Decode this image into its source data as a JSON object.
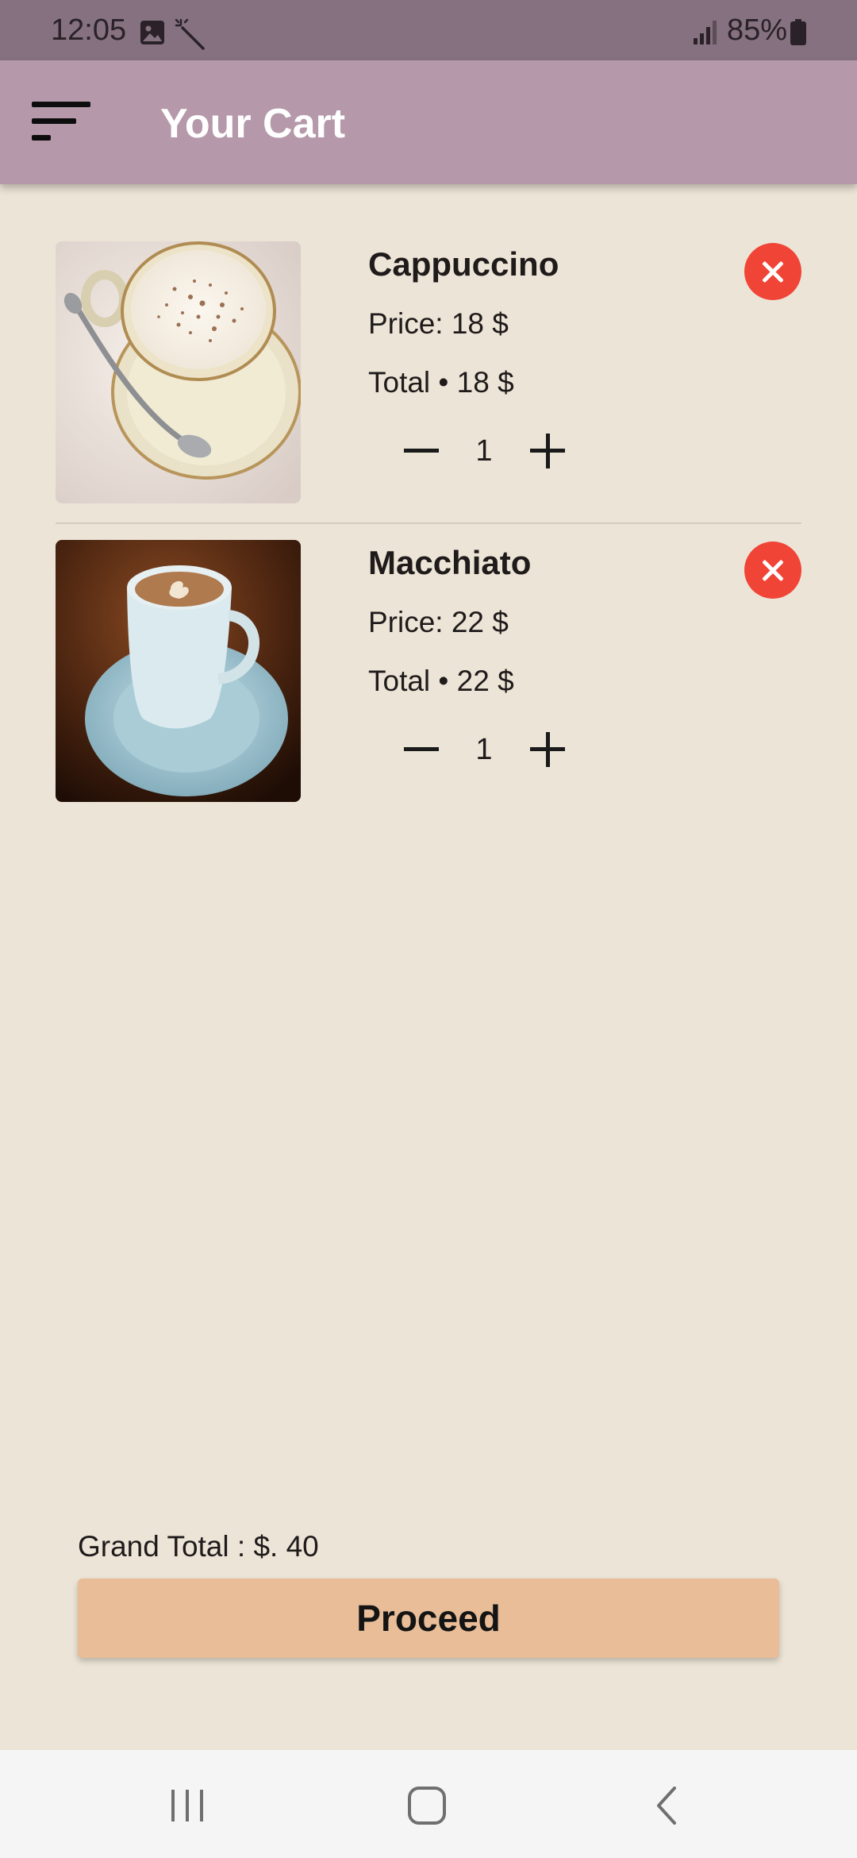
{
  "status_bar": {
    "time": "12:05",
    "battery": "85%",
    "icons": [
      "photo-icon",
      "magic-wand-icon",
      "signal-icon",
      "battery-icon"
    ]
  },
  "app_bar": {
    "title": "Your Cart",
    "menu_icon": "menu-icon"
  },
  "cart": {
    "items": [
      {
        "name": "Cappuccino",
        "price": "Price: 18 $",
        "total": "Total • 18 $",
        "quantity": "1",
        "image": "cappuccino-photo",
        "remove_icon": "close-icon"
      },
      {
        "name": "Macchiato",
        "price": "Price: 22 $",
        "total": "Total • 22 $",
        "quantity": "1",
        "image": "macchiato-photo",
        "remove_icon": "close-icon"
      }
    ]
  },
  "footer": {
    "grand_total": "Grand Total : $. 40",
    "proceed_label": "Proceed"
  },
  "nav_bar": {
    "icons": [
      "recent-apps-icon",
      "home-icon",
      "back-icon"
    ]
  },
  "colors": {
    "status_bar": "#867180",
    "app_bar": "#b599aa",
    "background": "#ece4d6",
    "remove_button": "#f04437",
    "proceed_button": "#e8bd98",
    "nav_bar": "#f5f5f5"
  }
}
